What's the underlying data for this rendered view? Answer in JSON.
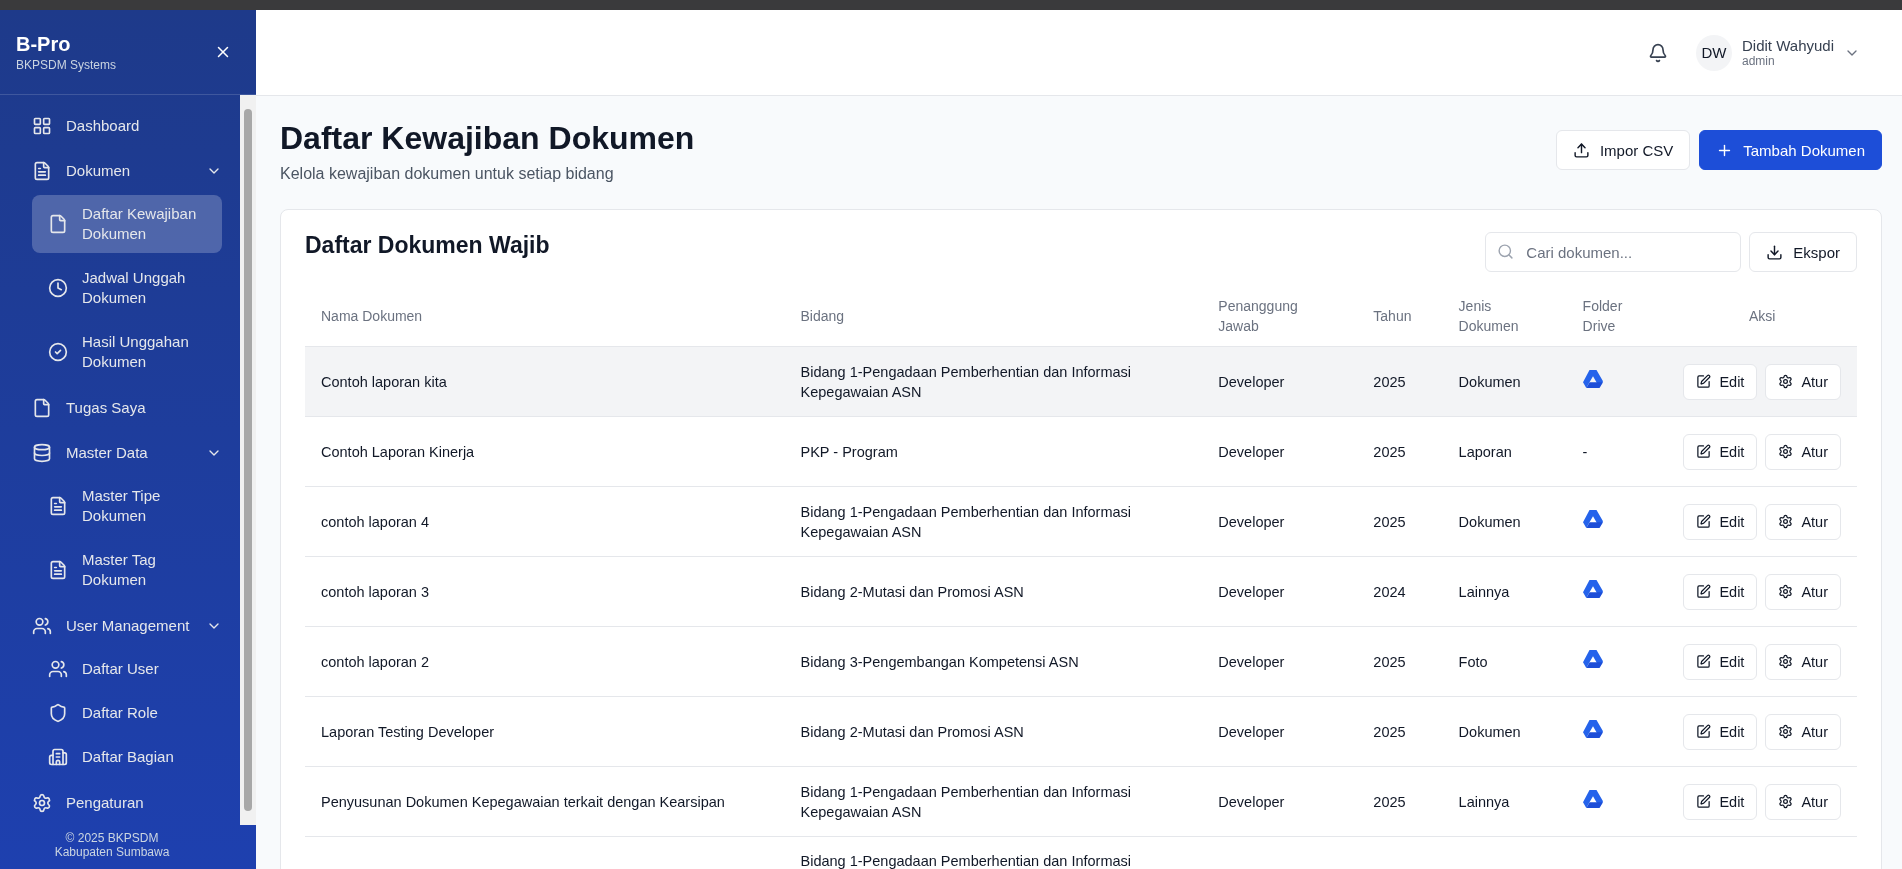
{
  "sidebar": {
    "brand": "B-Pro",
    "subtitle": "BKPSDM Systems",
    "items": [
      {
        "kind": "link",
        "label": "Dashboard",
        "selected": false
      },
      {
        "kind": "group",
        "label": "Dokumen",
        "expanded": true,
        "children": [
          {
            "label": "Daftar Kewajiban Dokumen",
            "selected": true
          },
          {
            "label": "Jadwal Unggah Dokumen",
            "selected": false
          },
          {
            "label": "Hasil Unggahan Dokumen",
            "selected": false
          }
        ]
      },
      {
        "kind": "link",
        "label": "Tugas Saya",
        "selected": false
      },
      {
        "kind": "group",
        "label": "Master Data",
        "expanded": true,
        "children": [
          {
            "label": "Master Tipe Dokumen",
            "selected": false
          },
          {
            "label": "Master Tag Dokumen",
            "selected": false
          }
        ]
      },
      {
        "kind": "group",
        "label": "User Management",
        "expanded": true,
        "children": [
          {
            "label": "Daftar User",
            "selected": false
          },
          {
            "label": "Daftar Role",
            "selected": false
          },
          {
            "label": "Daftar Bagian",
            "selected": false
          }
        ]
      },
      {
        "kind": "link",
        "label": "Pengaturan",
        "selected": false
      }
    ],
    "footer": [
      "© 2025 BKPSDM",
      "Kabupaten Sumbawa"
    ]
  },
  "header": {
    "initials": "DW",
    "user": "Didit Wahyudi",
    "role": "admin"
  },
  "page": {
    "title": "Daftar Kewajiban Dokumen",
    "subtitle": "Kelola kewajiban dokumen untuk setiap bidang",
    "buttons": [
      {
        "kind": "outline",
        "label": "Impor CSV"
      },
      {
        "kind": "primary",
        "label": "Tambah Dokumen"
      }
    ]
  },
  "card": {
    "title": "Daftar Dokumen Wajib",
    "search": {
      "placeholder": "Cari dokumen..."
    },
    "export": "Ekspor",
    "columns": [
      "Nama Dokumen",
      "Bidang",
      "Penanggung Jawab",
      "Tahun",
      "Jenis Dokumen",
      "Folder Drive",
      "Aksi"
    ],
    "rows": [
      {
        "name": "Contoh laporan kita",
        "bidang": "Bidang 1-Pengadaan Pemberhentian dan Informasi Kepegawaian ASN",
        "pj": "Developer",
        "tahun": "2025",
        "jenis": "Dokumen",
        "drive": true,
        "hovered": true,
        "edit": "Edit",
        "atur": "Atur"
      },
      {
        "name": "Contoh Laporan Kinerja",
        "bidang": "PKP - Program",
        "pj": "Developer",
        "tahun": "2025",
        "jenis": "Laporan",
        "drive": false,
        "drive_text": "-",
        "hovered": false,
        "edit": "Edit",
        "atur": "Atur"
      },
      {
        "name": "contoh laporan 4",
        "bidang": "Bidang 1-Pengadaan Pemberhentian dan Informasi Kepegawaian ASN",
        "pj": "Developer",
        "tahun": "2025",
        "jenis": "Dokumen",
        "drive": true,
        "hovered": false,
        "edit": "Edit",
        "atur": "Atur"
      },
      {
        "name": "contoh laporan 3",
        "bidang": "Bidang 2-Mutasi dan Promosi ASN",
        "pj": "Developer",
        "tahun": "2024",
        "jenis": "Lainnya",
        "drive": true,
        "hovered": false,
        "edit": "Edit",
        "atur": "Atur"
      },
      {
        "name": "contoh laporan 2",
        "bidang": "Bidang 3-Pengembangan Kompetensi ASN",
        "pj": "Developer",
        "tahun": "2025",
        "jenis": "Foto",
        "drive": true,
        "hovered": false,
        "edit": "Edit",
        "atur": "Atur"
      },
      {
        "name": "Laporan Testing Developer",
        "bidang": "Bidang 2-Mutasi dan Promosi ASN",
        "pj": "Developer",
        "tahun": "2025",
        "jenis": "Dokumen",
        "drive": true,
        "hovered": false,
        "edit": "Edit",
        "atur": "Atur"
      },
      {
        "name": "Penyusunan Dokumen Kepegawaian terkait dengan Kearsipan",
        "bidang": "Bidang 1-Pengadaan Pemberhentian dan Informasi Kepegawaian ASN",
        "pj": "Developer",
        "tahun": "2025",
        "jenis": "Lainnya",
        "drive": true,
        "hovered": false,
        "edit": "Edit",
        "atur": "Atur"
      }
    ],
    "partial_row": {
      "bidang": "Bidang 1-Pengadaan Pemberhentian dan Informasi"
    }
  }
}
